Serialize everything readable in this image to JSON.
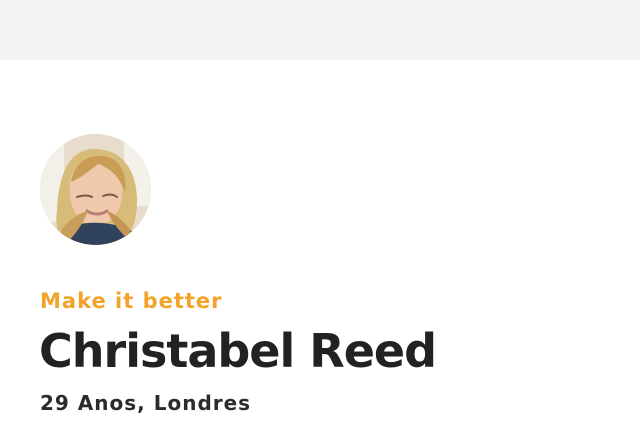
{
  "profile": {
    "tagline": "Make it better",
    "name": "Christabel Reed",
    "details": "29 Anos, Londres",
    "avatar": "profile-photo"
  },
  "colors": {
    "tagline": "#f3a329",
    "name": "#222222",
    "details": "#2b2b2b",
    "top_bar": "#f2f2f2",
    "background": "#ffffff"
  }
}
